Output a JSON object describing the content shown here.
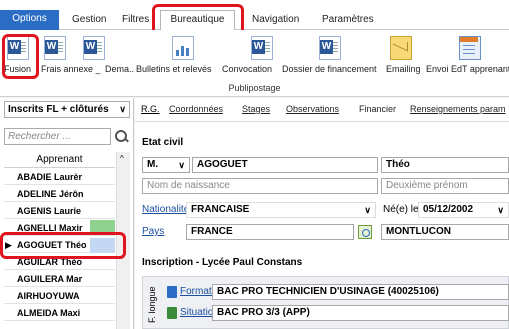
{
  "top_tabs": [
    "Options",
    "Gestion",
    "Filtres",
    "Bureautique",
    "Navigation",
    "Paramètres"
  ],
  "ribbon": {
    "buttons": [
      "Fusion",
      "Frais annexe _",
      "Dema..",
      "Bulletins et relevés",
      "Convocation",
      "Dossier de financement",
      "Emailing",
      "Envoi EdT apprenant"
    ],
    "group_label": "Publipostage"
  },
  "left_panel": {
    "filter_select": "Inscrits FL + clôturés",
    "search_placeholder": "Rechercher ...",
    "column_header": "Apprenant",
    "rows": [
      "ABADIE Laurèr",
      "ADELINE Jérôn",
      "AGENIS Laurie",
      "AGNELLI Maxir",
      "AGOGUET Théo",
      "AGUILAR Théo",
      "AGUILERA Mar",
      "AIRHUOYUWA",
      "ALMEIDA Maxi"
    ],
    "selected_index": 4
  },
  "sub_tabs": [
    "R.G.",
    "Coordonnées",
    "Stages",
    "Observations",
    "Financier",
    "Renseignements param"
  ],
  "etat_civil": {
    "title": "Etat civil",
    "civility": "M.",
    "last_name": "AGOGUET",
    "first_name": "Théo",
    "birth_name_placeholder": "Nom de naissance",
    "second_name_placeholder": "Deuxième prénom",
    "nationality_label": "Nationalité",
    "nationality": "FRANCAISE",
    "born_label": "Né(e) le",
    "birth_date": "05/12/2002",
    "country_label": "Pays",
    "country": "FRANCE",
    "city": "MONTLUCON"
  },
  "inscription": {
    "title": "Inscription - Lycée Paul Constans",
    "vertical_label": "F. longue",
    "formation_label": "Formation",
    "formation": "BAC PRO TECHNICIEN D'USINAGE (40025106)",
    "situation_label": "Situation",
    "situation": "BAC PRO 3/3 (APP)"
  },
  "colors": {
    "accent": "#2b6cc4",
    "highlight": "#e0141e",
    "selected_row": "#c5d8f3"
  }
}
